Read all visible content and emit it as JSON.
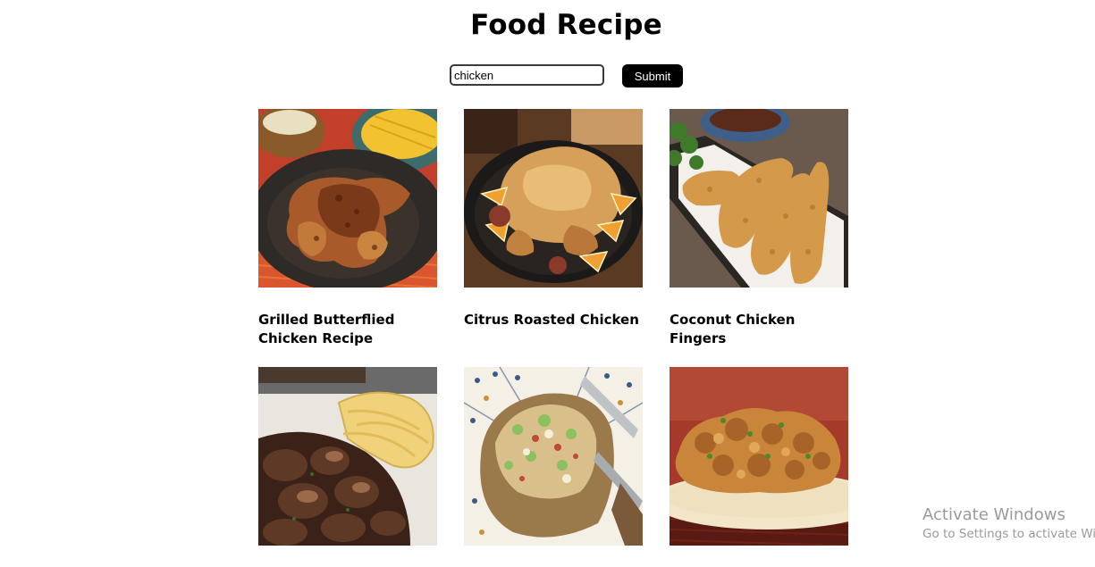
{
  "header": {
    "title": "Food Recipe"
  },
  "search": {
    "value": "chicken",
    "submit_label": "Submit"
  },
  "recipes": [
    {
      "title": "Grilled Butterflied Chicken Recipe",
      "image": "grilled-chicken-photo"
    },
    {
      "title": "Citrus Roasted Chicken",
      "image": "roasted-chicken-photo"
    },
    {
      "title": "Coconut Chicken Fingers",
      "image": "chicken-fingers-photo"
    },
    {
      "title": "",
      "image": "chicken-mushroom-pasta-photo"
    },
    {
      "title": "",
      "image": "stuffed-baked-potato-photo"
    },
    {
      "title": "",
      "image": "chicken-fritters-photo"
    }
  ],
  "watermark": {
    "line1": "Activate Windows",
    "line2": "Go to Settings to activate Windows."
  }
}
